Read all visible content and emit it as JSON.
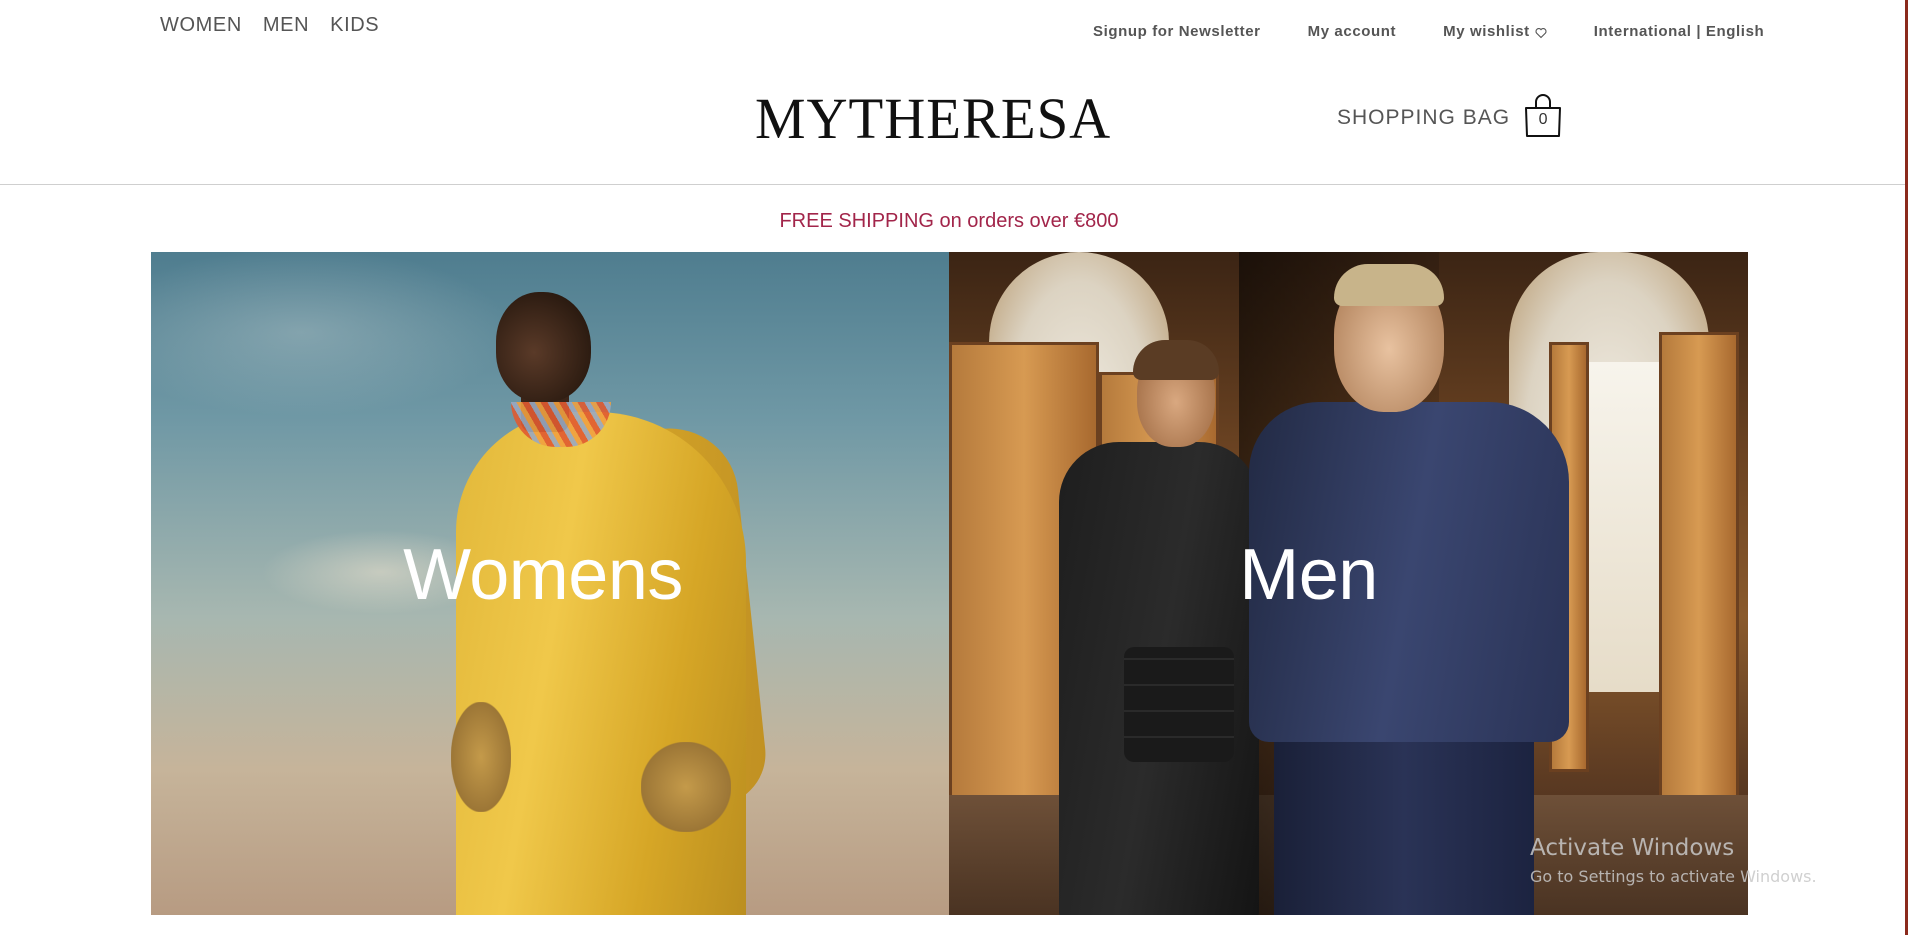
{
  "top_nav": {
    "items": [
      "WOMEN",
      "MEN",
      "KIDS"
    ]
  },
  "utility_links": {
    "newsletter": "Signup for Newsletter",
    "account": "My account",
    "wishlist": "My wishlist",
    "locale": "International | English"
  },
  "logo": {
    "text": "MYTHERESA"
  },
  "shopping_bag": {
    "label": "SHOPPING BAG",
    "count": "0"
  },
  "banner": {
    "text": "FREE SHIPPING on orders over €800",
    "color": "#a2254a"
  },
  "hero": {
    "panels": [
      {
        "title": "Womens",
        "image": "womens-campaign-photo"
      },
      {
        "title": "Men",
        "image": "mens-campaign-photo"
      }
    ]
  },
  "watermark": {
    "line1": "Activate Windows",
    "line2": "Go to Settings to activate Windows."
  },
  "icons": {
    "wishlist": "heart-icon",
    "bag": "shopping-bag-icon"
  }
}
